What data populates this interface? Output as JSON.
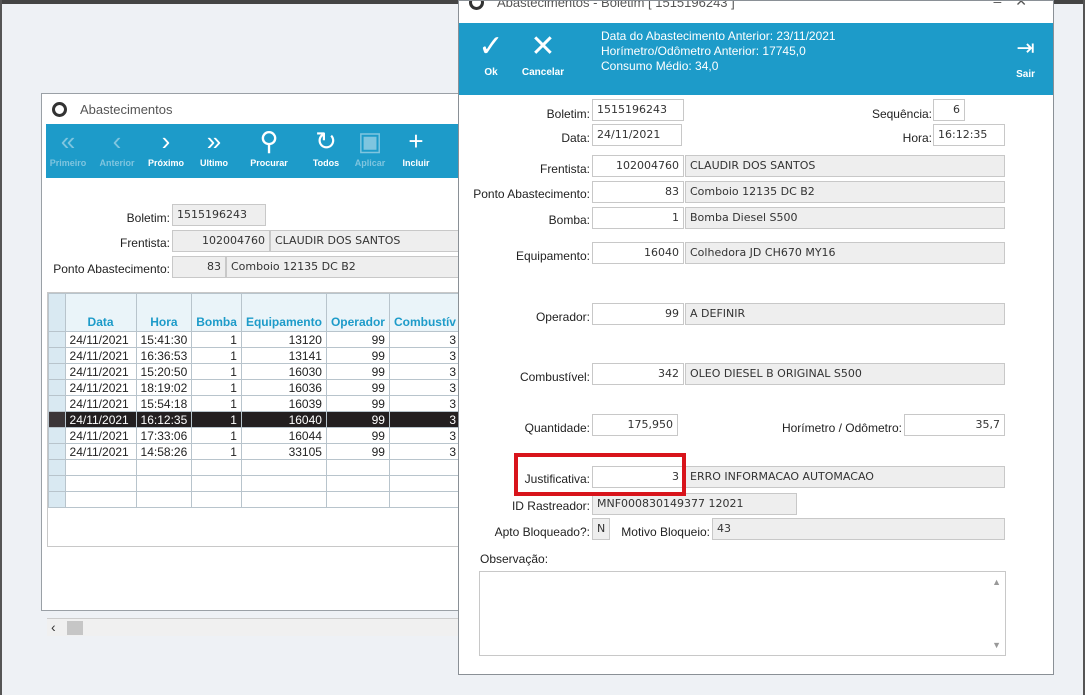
{
  "back_window": {
    "title": "Abastecimentos",
    "toolbar": [
      {
        "icon": "double-chevron-left-icon",
        "glyph": "«",
        "label": "Primeiro",
        "enabled": false
      },
      {
        "icon": "chevron-left-icon",
        "glyph": "‹",
        "label": "Anterior",
        "enabled": false
      },
      {
        "icon": "chevron-right-icon",
        "glyph": "›",
        "label": "Próximo",
        "enabled": true
      },
      {
        "icon": "double-chevron-right-icon",
        "glyph": "»",
        "label": "Ultimo",
        "enabled": true
      },
      {
        "icon": "search-icon",
        "glyph": "⚲",
        "label": "Procurar",
        "enabled": true
      },
      {
        "icon": "refresh-icon",
        "glyph": "↻",
        "label": "Todos",
        "enabled": true
      },
      {
        "icon": "save-icon",
        "glyph": "▣",
        "label": "Aplicar",
        "enabled": false
      },
      {
        "icon": "plus-icon",
        "glyph": "+",
        "label": "Incluir",
        "enabled": true
      }
    ],
    "form": {
      "boletim_label": "Boletim:",
      "boletim_value": "1515196243",
      "frentista_label": "Frentista:",
      "frentista_code": "102004760",
      "frentista_name": "CLAUDIR DOS SANTOS",
      "ponto_label": "Ponto Abastecimento:",
      "ponto_code": "83",
      "ponto_name": "Comboio 12135  DC B2"
    },
    "grid": {
      "columns": [
        "Data",
        "Hora",
        "Bomba",
        "Equipamento",
        "Operador",
        "Combustív"
      ],
      "rows": [
        [
          "24/11/2021",
          "15:41:30",
          "1",
          "13120",
          "99",
          "3"
        ],
        [
          "24/11/2021",
          "16:36:53",
          "1",
          "13141",
          "99",
          "3"
        ],
        [
          "24/11/2021",
          "15:20:50",
          "1",
          "16030",
          "99",
          "3"
        ],
        [
          "24/11/2021",
          "18:19:02",
          "1",
          "16036",
          "99",
          "3"
        ],
        [
          "24/11/2021",
          "15:54:18",
          "1",
          "16039",
          "99",
          "3"
        ],
        [
          "24/11/2021",
          "16:12:35",
          "1",
          "16040",
          "99",
          "3"
        ],
        [
          "24/11/2021",
          "17:33:06",
          "1",
          "16044",
          "99",
          "3"
        ],
        [
          "24/11/2021",
          "14:58:26",
          "1",
          "33105",
          "99",
          "3"
        ]
      ],
      "selected_row": 5
    }
  },
  "front_window": {
    "title": "Abastecimentos - Boletim [ 1515196243 ]",
    "toolbar": {
      "ok_label": "Ok",
      "cancel_label": "Cancelar",
      "exit_label": "Sair",
      "info_line1": "Data do Abastecimento Anterior: 23/11/2021",
      "info_line2": "Horímetro/Odômetro Anterior: 17745,0",
      "info_line3": "Consumo Médio: 34,0"
    },
    "form": {
      "boletim_label": "Boletim:",
      "boletim_value": "1515196243",
      "sequencia_label": "Sequência:",
      "sequencia_value": "6",
      "data_label": "Data:",
      "data_value": "24/11/2021",
      "hora_label": "Hora:",
      "hora_value": "16:12:35",
      "frentista_label": "Frentista:",
      "frentista_code": "102004760",
      "frentista_name": "CLAUDIR DOS SANTOS",
      "ponto_label": "Ponto Abastecimento:",
      "ponto_code": "83",
      "ponto_name": "Comboio 12135  DC B2",
      "bomba_label": "Bomba:",
      "bomba_code": "1",
      "bomba_name": "Bomba Diesel S500",
      "equipamento_label": "Equipamento:",
      "equipamento_code": "16040",
      "equipamento_name": "Colhedora JD CH670 MY16",
      "operador_label": "Operador:",
      "operador_code": "99",
      "operador_name": "A DEFINIR",
      "combustivel_label": "Combustível:",
      "combustivel_code": "342",
      "combustivel_name": "OLEO DIESEL B ORIGINAL S500",
      "quantidade_label": "Quantidade:",
      "quantidade_value": "175,950",
      "horimetro_label": "Horímetro / Odômetro:",
      "horimetro_value": "35,7",
      "justificativa_label": "Justificativa:",
      "justificativa_code": "3",
      "justificativa_name": "ERRO INFORMACAO AUTOMACAO",
      "rastreador_label": "ID Rastreador:",
      "rastreador_value": "MNF000830149377 12021",
      "apto_label": "Apto Bloqueado?:",
      "apto_value": "N",
      "motivo_label": "Motivo Bloqueio:",
      "motivo_value": "43",
      "observacao_label": "Observação:"
    }
  },
  "colors": {
    "toolbar_blue": "#1d9bc9",
    "highlight_red": "#d8141b",
    "selected_row": "#231f20"
  }
}
